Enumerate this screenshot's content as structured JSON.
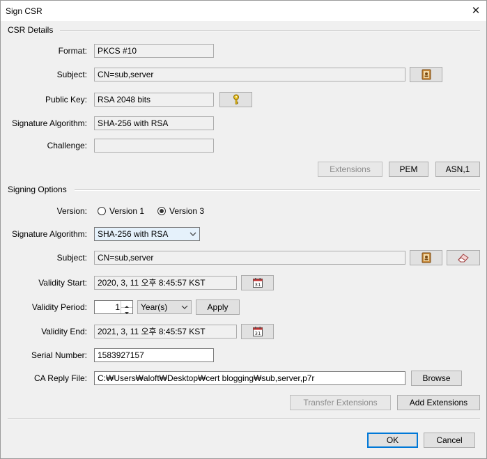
{
  "window": {
    "title": "Sign CSR",
    "close_icon": "close-icon"
  },
  "csr_details": {
    "section_title": "CSR Details",
    "format_label": "Format:",
    "format_value": "PKCS #10",
    "subject_label": "Subject:",
    "subject_value": "CN=sub,server",
    "public_key_label": "Public Key:",
    "public_key_value": "RSA 2048 bits",
    "sig_alg_label": "Signature Algorithm:",
    "sig_alg_value": "SHA-256 with RSA",
    "challenge_label": "Challenge:",
    "challenge_value": "",
    "extensions_button": "Extensions",
    "pem_button": "PEM",
    "asn1_button": "ASN,1"
  },
  "signing_options": {
    "section_title": "Signing Options",
    "version_label": "Version:",
    "version1_label": "Version 1",
    "version3_label": "Version 3",
    "selected_version": "Version 3",
    "sig_alg_label": "Signature Algorithm:",
    "sig_alg_selected": "SHA-256 with RSA",
    "subject_label": "Subject:",
    "subject_value": "CN=sub,server",
    "validity_start_label": "Validity Start:",
    "validity_start_value": "2020, 3, 11 오후 8:45:57 KST",
    "validity_period_label": "Validity Period:",
    "validity_period_value": "1",
    "validity_period_unit": "Year(s)",
    "apply_button": "Apply",
    "validity_end_label": "Validity End:",
    "validity_end_value": "2021, 3, 11 오후 8:45:57 KST",
    "serial_label": "Serial Number:",
    "serial_value": "1583927157",
    "ca_reply_label": "CA Reply File:",
    "ca_reply_value": "C:₩Users₩aloft₩Desktop₩cert blogging₩sub,server,p7r",
    "browse_button": "Browse",
    "transfer_ext_button": "Transfer Extensions",
    "add_ext_button": "Add Extensions"
  },
  "footer": {
    "ok_button": "OK",
    "cancel_button": "Cancel"
  },
  "colors": {
    "accent": "#0078d7",
    "dialog_bg": "#f0f0f0",
    "combo_bg": "#e5f1fb"
  }
}
